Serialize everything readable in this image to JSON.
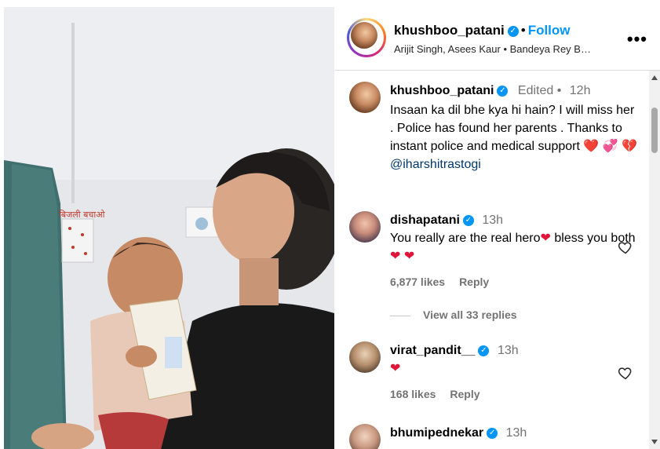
{
  "post": {
    "username": "khushboo_patani",
    "follow_label": "Follow",
    "audio": "Arijit Singh, Asees Kaur • Bandeya Rey B…",
    "more_label": "•••"
  },
  "media": {
    "wall_sign": "बिजली बचाओ",
    "wall_sign2": "बिजली बचाओ"
  },
  "comments": [
    {
      "username": "khushboo_patani",
      "edited": "Edited",
      "time": "12h",
      "text": "Insaan ka dil bhe kya hi hain? I will miss her . Police has found her parents . Thanks to instant police and medical support",
      "emojis": "❤️ 💞 💔",
      "mention": "@iharshitrastogi"
    },
    {
      "username": "dishapatani",
      "time": "13h",
      "text_a": "You really are the real hero",
      "text_b": " bless you both",
      "heart_a": "❤",
      "heart_b": "❤ ❤",
      "likes": "6,877 likes",
      "reply_label": "Reply",
      "view_replies": "View all 33 replies"
    },
    {
      "username": "virat_pandit__",
      "time": "13h",
      "text": "❤",
      "likes": "168 likes",
      "reply_label": "Reply"
    },
    {
      "username": "bhumipednekar",
      "time": "13h"
    }
  ],
  "colors": {
    "accent": "#0095f6",
    "muted": "#737373",
    "mention": "#00376b",
    "heart": "#e0153a"
  }
}
